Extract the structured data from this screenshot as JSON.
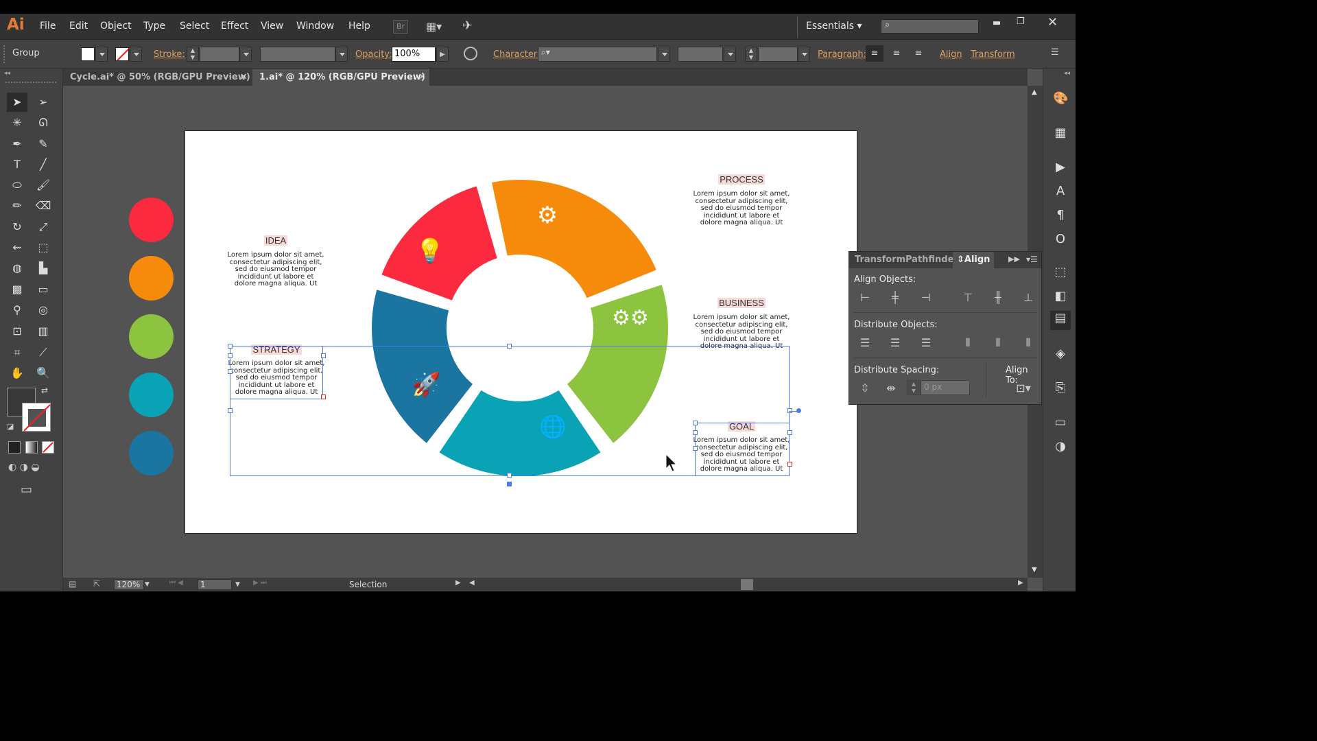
{
  "app": {
    "logo": "Ai",
    "workspace": "Essentials",
    "search_placeholder": ""
  },
  "menu": [
    "File",
    "Edit",
    "Object",
    "Type",
    "Select",
    "Effect",
    "View",
    "Window",
    "Help"
  ],
  "menu_extra": {
    "bridge": "Br"
  },
  "control": {
    "selection_type": "Group",
    "stroke_label": "Stroke:",
    "opacity_label": "Opacity:",
    "opacity_value": "100%",
    "character_label": "Character:",
    "paragraph_label": "Paragraph:",
    "align_link": "Align",
    "transform_link": "Transform"
  },
  "tabs": [
    {
      "label": "Cycle.ai* @ 50% (RGB/GPU Preview)",
      "active": false
    },
    {
      "label": "1.ai* @ 120% (RGB/GPU Preview)",
      "active": true
    }
  ],
  "artboard": {
    "swatches": [
      "#fb2a3f",
      "#f68a0b",
      "#8dc43f",
      "#0aa3b5",
      "#1a75a0"
    ],
    "segments": [
      {
        "name": "idea",
        "color": "#fb2a3f",
        "icon": "lightbulb-icon"
      },
      {
        "name": "process",
        "color": "#f68a0b",
        "icon": "head-gear-icon"
      },
      {
        "name": "business",
        "color": "#8dc43f",
        "icon": "gears-icon"
      },
      {
        "name": "goal",
        "color": "#0aa3b5",
        "icon": "globe-icon"
      },
      {
        "name": "strategy",
        "color": "#1a75a0",
        "icon": "rocket-icon"
      }
    ],
    "blocks": {
      "idea": {
        "title": "IDEA",
        "lines": [
          "Lorem ipsum dolor sit amet,",
          "consectetur adipiscing elit,",
          "sed do eiusmod tempor",
          "incididunt ut labore et",
          "dolore magna aliqua. Ut"
        ]
      },
      "process": {
        "title": "PROCESS",
        "lines": [
          "Lorem ipsum dolor sit amet,",
          "consectetur adipiscing elit,",
          "sed do eiusmod tempor",
          "incididunt ut labore et",
          "dolore magna aliqua. Ut"
        ]
      },
      "business": {
        "title": "BUSINESS",
        "lines": [
          "Lorem ipsum dolor sit amet,",
          "consectetur adipiscing elit,",
          "sed do eiusmod tempor",
          "incididunt ut labore et",
          "dolore magna aliqua. Ut"
        ]
      },
      "strategy": {
        "title": "STRATEGY",
        "lines": [
          "Lorem ipsum dolor sit amet,",
          "consectetur adipiscing elit,",
          "sed do eiusmod tempor",
          "incididunt ut labore et",
          "dolore magna aliqua. Ut"
        ]
      },
      "goal": {
        "title": "GOAL",
        "lines": [
          "Lorem ipsum dolor sit amet,",
          "consectetur adipiscing elit,",
          "sed do eiusmod tempor",
          "incididunt ut labore et",
          "dolore magna aliqua. Ut"
        ]
      }
    }
  },
  "align_panel": {
    "tabs": [
      "Transform",
      "Pathfinder",
      "Align"
    ],
    "active_tab": "Align",
    "align_objects": "Align Objects:",
    "distribute_objects": "Distribute Objects:",
    "distribute_spacing": "Distribute Spacing:",
    "align_to": "Align To:",
    "spacing_value": "0 px"
  },
  "status": {
    "zoom": "120%",
    "page": "1",
    "tool": "Selection"
  },
  "colors": {
    "accent_select": "#4c7de6",
    "label_orange": "#e0a060"
  }
}
